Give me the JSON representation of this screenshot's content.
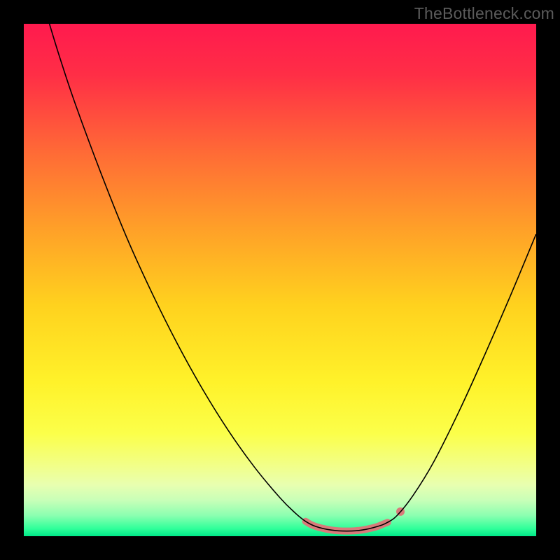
{
  "watermark": "TheBottleneck.com",
  "chart_data": {
    "type": "line",
    "title": "",
    "xlabel": "",
    "ylabel": "",
    "xlim": [
      0,
      100
    ],
    "ylim": [
      0,
      100
    ],
    "background_gradient": {
      "stops": [
        {
          "offset": 0.0,
          "color": "#ff1a4e"
        },
        {
          "offset": 0.1,
          "color": "#ff2e46"
        },
        {
          "offset": 0.25,
          "color": "#ff6a36"
        },
        {
          "offset": 0.4,
          "color": "#ffa028"
        },
        {
          "offset": 0.55,
          "color": "#ffd21e"
        },
        {
          "offset": 0.7,
          "color": "#fff22a"
        },
        {
          "offset": 0.8,
          "color": "#fbff4a"
        },
        {
          "offset": 0.86,
          "color": "#f2ff86"
        },
        {
          "offset": 0.9,
          "color": "#e8ffb0"
        },
        {
          "offset": 0.93,
          "color": "#c8ffb8"
        },
        {
          "offset": 0.96,
          "color": "#8affb0"
        },
        {
          "offset": 0.985,
          "color": "#30ff9a"
        },
        {
          "offset": 1.0,
          "color": "#00e888"
        }
      ]
    },
    "series": [
      {
        "name": "bottleneck-curve",
        "type": "line",
        "color": "#000000",
        "width": 1.6,
        "points": [
          {
            "x": 5.0,
            "y": 100.0
          },
          {
            "x": 7.0,
            "y": 93.5
          },
          {
            "x": 10.0,
            "y": 84.5
          },
          {
            "x": 15.0,
            "y": 71.0
          },
          {
            "x": 20.0,
            "y": 58.5
          },
          {
            "x": 25.0,
            "y": 47.5
          },
          {
            "x": 30.0,
            "y": 37.5
          },
          {
            "x": 35.0,
            "y": 28.5
          },
          {
            "x": 40.0,
            "y": 20.5
          },
          {
            "x": 45.0,
            "y": 13.5
          },
          {
            "x": 50.0,
            "y": 7.5
          },
          {
            "x": 53.0,
            "y": 4.5
          },
          {
            "x": 55.0,
            "y": 2.9
          },
          {
            "x": 57.0,
            "y": 1.9
          },
          {
            "x": 60.0,
            "y": 1.2
          },
          {
            "x": 63.0,
            "y": 1.0
          },
          {
            "x": 66.0,
            "y": 1.2
          },
          {
            "x": 69.0,
            "y": 1.9
          },
          {
            "x": 71.0,
            "y": 2.7
          },
          {
            "x": 73.0,
            "y": 4.2
          },
          {
            "x": 76.0,
            "y": 8.0
          },
          {
            "x": 80.0,
            "y": 14.5
          },
          {
            "x": 85.0,
            "y": 24.5
          },
          {
            "x": 90.0,
            "y": 35.5
          },
          {
            "x": 95.0,
            "y": 47.0
          },
          {
            "x": 100.0,
            "y": 59.0
          }
        ]
      },
      {
        "name": "bottom-marker-band",
        "type": "line",
        "color": "#d87a7a",
        "width": 10,
        "cap": "round",
        "points": [
          {
            "x": 55.0,
            "y": 2.9
          },
          {
            "x": 56.0,
            "y": 2.3
          },
          {
            "x": 57.0,
            "y": 1.9
          },
          {
            "x": 58.5,
            "y": 1.5
          },
          {
            "x": 60.0,
            "y": 1.2
          },
          {
            "x": 61.5,
            "y": 1.05
          },
          {
            "x": 63.0,
            "y": 1.0
          },
          {
            "x": 64.5,
            "y": 1.05
          },
          {
            "x": 66.0,
            "y": 1.2
          },
          {
            "x": 67.5,
            "y": 1.5
          },
          {
            "x": 69.0,
            "y": 1.9
          },
          {
            "x": 70.0,
            "y": 2.3
          },
          {
            "x": 71.0,
            "y": 2.7
          }
        ]
      },
      {
        "name": "right-marker-dot",
        "type": "scatter",
        "color": "#d87a7a",
        "radius": 6,
        "points": [
          {
            "x": 73.5,
            "y": 4.8
          }
        ]
      }
    ]
  }
}
